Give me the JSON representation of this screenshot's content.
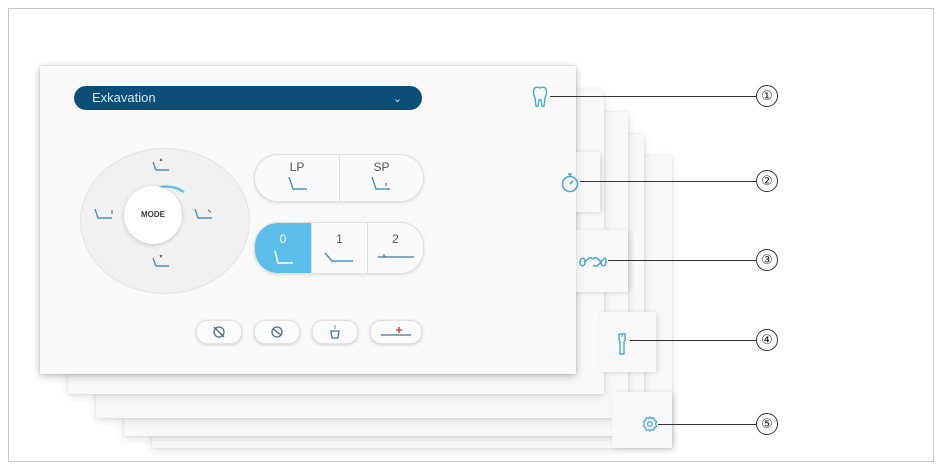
{
  "panel": {
    "program_select": {
      "value": "Exkavation"
    },
    "mode_wheel": {
      "center_label": "MODE"
    },
    "positions": [
      {
        "label": "LP"
      },
      {
        "label": "SP"
      }
    ],
    "memory_positions": [
      {
        "label": "0",
        "active": true
      },
      {
        "label": "1",
        "active": false
      },
      {
        "label": "2",
        "active": false
      }
    ],
    "function_buttons": [
      {
        "icon": "light-off-icon"
      },
      {
        "icon": "light-icon"
      },
      {
        "icon": "cup-filler-icon"
      },
      {
        "icon": "rinse-position-icon"
      }
    ]
  },
  "tabs": [
    {
      "icon": "tooth-icon",
      "callout": "①"
    },
    {
      "icon": "stopwatch-icon",
      "callout": "②"
    },
    {
      "icon": "infinity-icon",
      "callout": "③"
    },
    {
      "icon": "instrument-icon",
      "callout": "④"
    },
    {
      "icon": "gear-icon",
      "callout": "⑤"
    }
  ],
  "colors": {
    "accent": "#5bbde9",
    "dropdown_bg": "#0b4f78",
    "icon": "#4aa9d8"
  }
}
